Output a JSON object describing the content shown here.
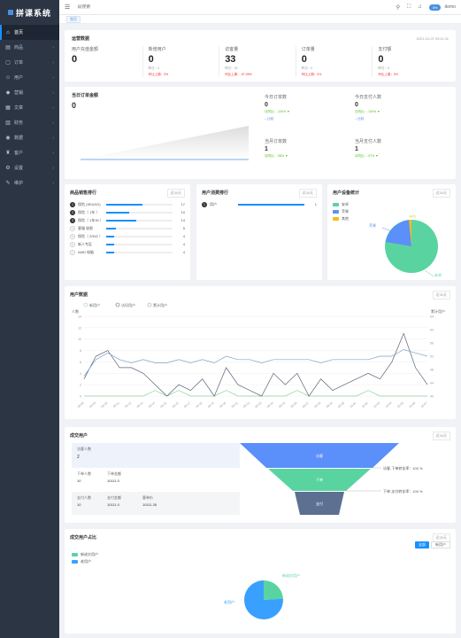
{
  "app": {
    "logo": "拼课系统"
  },
  "sidebar": {
    "items": [
      {
        "icon": "⌂",
        "label": "首页",
        "active": true,
        "arrow": ""
      },
      {
        "icon": "▤",
        "label": "商品",
        "arrow": "›"
      },
      {
        "icon": "▢",
        "label": "订单",
        "arrow": "›"
      },
      {
        "icon": "☺",
        "label": "用户",
        "arrow": "›"
      },
      {
        "icon": "◆",
        "label": "营销",
        "arrow": "›"
      },
      {
        "icon": "▦",
        "label": "文章",
        "arrow": "›"
      },
      {
        "icon": "▥",
        "label": "财务",
        "arrow": "›"
      },
      {
        "icon": "◉",
        "label": "数据",
        "arrow": "›"
      },
      {
        "icon": "♜",
        "label": "客户",
        "arrow": "›"
      },
      {
        "icon": "⚙",
        "label": "设置",
        "arrow": "›"
      },
      {
        "icon": "✎",
        "label": "维护",
        "arrow": "›"
      }
    ]
  },
  "topbar": {
    "search_placeholder": "请搜索",
    "badge": "0%",
    "user": "demo"
  },
  "tags": {
    "home": "首页"
  },
  "overview": {
    "title": "运营数据",
    "time": "2021-10-07 09:11:11",
    "stats": [
      {
        "label": "用户充值金额",
        "value": "0",
        "sub1": "",
        "sub2": ""
      },
      {
        "label": "新增用户",
        "value": "0",
        "sub1": "昨日：0",
        "sub2": "环比上周：0%"
      },
      {
        "label": "访客量",
        "value": "33",
        "sub1": "昨日：34",
        "sub2": "环比上周：-97.25%"
      },
      {
        "label": "订单量",
        "value": "0",
        "sub1": "昨日：0",
        "sub2": "环比上周：0%"
      },
      {
        "label": "支付额",
        "value": "0",
        "sub1": "昨日：0",
        "sub2": "环比上周：0%"
      }
    ]
  },
  "trade": {
    "title": "当日订单金额",
    "value": "0",
    "cards": [
      {
        "label": "今日订单数",
        "value": "0",
        "sub": "日同比：-100% ▼",
        "link": "-- 比较"
      },
      {
        "label": "今日支付人数",
        "value": "0",
        "sub": "日同比：-100% ▼",
        "link": "-- 比较"
      },
      {
        "label": "当月订单数",
        "value": "1",
        "sub": "月同比：-98% ▼"
      },
      {
        "label": "当月支付人数",
        "value": "1",
        "sub": "月同比：-97% ▼"
      }
    ]
  },
  "goods_rank": {
    "title": "商品销售排行",
    "select": "近30天",
    "rows": [
      {
        "no": "1",
        "name": "保险 (SEASG)",
        "value": "17",
        "pct": 0.55,
        "plain": false
      },
      {
        "no": "2",
        "name": "保险（ 1年 ）",
        "value": "10",
        "pct": 0.35,
        "plain": false
      },
      {
        "no": "3",
        "name": "保险（ 1年30 ）",
        "value": "14",
        "pct": 0.45,
        "plain": false
      },
      {
        "no": "4",
        "name": "客服 收款",
        "value": "5",
        "pct": 0.15,
        "plain": true
      },
      {
        "no": "5",
        "name": "保险（ 200G ）",
        "value": "4",
        "pct": 0.12,
        "plain": true
      },
      {
        "no": "6",
        "name": "新人专区",
        "value": "4",
        "pct": 0.12,
        "plain": true
      },
      {
        "no": "7",
        "name": "AMD 电脑",
        "value": "4",
        "pct": 0.12,
        "plain": true
      }
    ]
  },
  "user_rank": {
    "title": "用户消费排行",
    "select": "近30天",
    "rows": [
      {
        "no": "1",
        "name": "用户",
        "value": "1",
        "pct": 1.0,
        "plain": false
      }
    ]
  },
  "device": {
    "title": "用户设备统计",
    "select": "近30天",
    "legend": [
      {
        "label": "安卓",
        "color": "#59d4a0"
      },
      {
        "label": "苹果",
        "color": "#5b8ff9"
      },
      {
        "label": "其他",
        "color": "#f6bd16"
      }
    ],
    "labels": {
      "a": "安卓",
      "b": "苹果",
      "c": "其他"
    }
  },
  "user_data": {
    "title": "用户数据",
    "select": "近30天",
    "legend": [
      "新用户",
      "访问用户",
      "累计用户"
    ],
    "y_left_label": "人数",
    "y_right_label": "累计用户",
    "colors": [
      "#8fd19e",
      "#5a6378",
      "#7fa4c8"
    ],
    "chart_data": {
      "type": "line",
      "categories": [
        "09-08",
        "09-09",
        "09-10",
        "09-11",
        "09-12",
        "09-13",
        "09-14",
        "09-15",
        "09-16",
        "09-17",
        "09-18",
        "09-19",
        "09-20",
        "09-21",
        "09-22",
        "09-23",
        "09-24",
        "09-25",
        "09-26",
        "09-27",
        "09-28",
        "09-29",
        "09-30",
        "10-01",
        "10-02",
        "10-03",
        "10-04",
        "10-05",
        "10-06",
        "10-07"
      ],
      "ylim": [
        0,
        14
      ],
      "yticks": [
        "0",
        "2",
        "4",
        "6",
        "8",
        "10",
        "12",
        "14"
      ],
      "y2lim": [
        40,
        64
      ],
      "y2ticks": [
        "40",
        "44",
        "48",
        "52",
        "56",
        "60",
        "64"
      ],
      "series": [
        {
          "name": "新用户",
          "values": [
            0,
            0,
            0,
            0,
            0,
            0,
            1,
            0,
            1,
            0,
            0,
            0,
            1,
            0,
            0,
            0,
            0,
            0,
            1,
            0,
            0,
            0,
            0,
            0,
            1,
            0,
            0,
            0,
            0,
            0
          ]
        },
        {
          "name": "访问用户",
          "values": [
            3,
            7,
            8,
            5,
            5,
            4,
            2,
            0,
            2,
            1,
            3,
            0,
            5,
            2,
            1,
            0,
            4,
            2,
            4,
            0,
            3,
            1,
            2,
            3,
            4,
            3,
            6,
            11,
            5,
            2
          ]
        },
        {
          "name": "累计用户",
          "values": [
            46,
            51,
            53,
            51,
            50,
            51,
            50,
            50,
            51,
            50,
            51,
            50,
            52,
            51,
            51,
            50,
            51,
            51,
            51,
            51,
            50,
            51,
            51,
            51,
            51,
            52,
            52,
            54,
            53,
            52
          ]
        }
      ]
    }
  },
  "funnel": {
    "title": "成交用户",
    "select": "近30天",
    "rows": [
      {
        "label": "访客人数",
        "value": "2"
      },
      {
        "labels": [
          "下单人数",
          "下单金额"
        ],
        "values": [
          "10",
          "10111.0"
        ]
      },
      {
        "labels": [
          "支付人数",
          "支付金额",
          "客单价"
        ],
        "values": [
          "10",
          "10111.0",
          "10111.35"
        ]
      }
    ],
    "levels": [
      "访客",
      "下单",
      "支付"
    ],
    "rates": [
      "访客-下单转化率：100 %",
      "下单-支付转化率：100 %"
    ]
  },
  "buyer": {
    "title": "成交用户占比",
    "select": "近30天",
    "buttons": [
      "全部",
      "新用户"
    ],
    "legend": [
      {
        "label": "新成交用户",
        "color": "#59d4a0"
      },
      {
        "label": "老用户",
        "color": "#3aa0ff"
      }
    ],
    "labels": {
      "a": "新成交用户",
      "b": "老用户"
    },
    "chart_data": {
      "type": "pie",
      "values": [
        24,
        76
      ],
      "labels": [
        "新成交用户",
        "老用户"
      ]
    }
  }
}
